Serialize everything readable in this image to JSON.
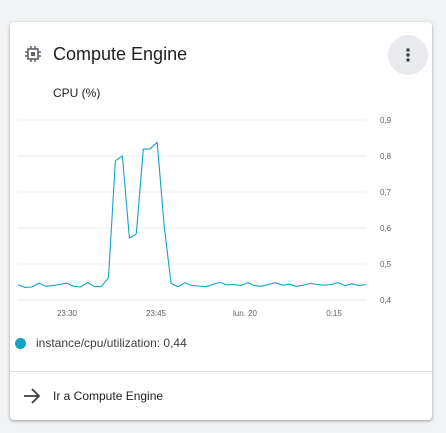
{
  "card": {
    "title": "Compute Engine",
    "menu_icon": "more-vert-icon",
    "title_icon": "chip-icon"
  },
  "chart_data": {
    "type": "line",
    "title": "CPU (%)",
    "x_ticks": [
      "23:30",
      "23:45",
      "lun. 20",
      "0:15"
    ],
    "y_ticks": [
      "0,4",
      "0,5",
      "0,6",
      "0,7",
      "0,8",
      "0,9"
    ],
    "ylim": [
      0.4,
      0.9
    ],
    "grid": true,
    "series": [
      {
        "name": "instance/cpu/utilization",
        "color": "#12a4c4",
        "values": [
          0.442,
          0.435,
          0.436,
          0.447,
          0.438,
          0.44,
          0.443,
          0.447,
          0.438,
          0.436,
          0.449,
          0.437,
          0.438,
          0.462,
          0.787,
          0.8,
          0.572,
          0.584,
          0.819,
          0.82,
          0.838,
          0.605,
          0.446,
          0.437,
          0.448,
          0.44,
          0.439,
          0.437,
          0.443,
          0.449,
          0.442,
          0.443,
          0.44,
          0.448,
          0.44,
          0.438,
          0.443,
          0.448,
          0.441,
          0.444,
          0.438,
          0.441,
          0.446,
          0.443,
          0.441,
          0.443,
          0.448,
          0.44,
          0.445,
          0.44,
          0.443
        ]
      }
    ]
  },
  "legend": {
    "label": "instance/cpu/utilization: 0,44"
  },
  "footer": {
    "link_label": "Ir a Compute Engine",
    "link_icon": "arrow-right-icon"
  }
}
